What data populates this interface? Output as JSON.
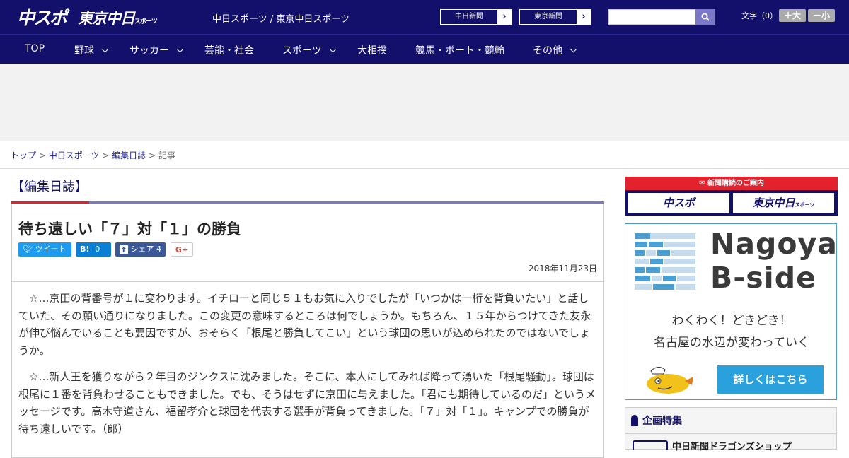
{
  "header": {
    "logo_chuspo": "中スポ",
    "logo_tokyo": "東京中日",
    "logo_tokyo_sub": "スポーツ",
    "site_name": "中日スポーツ / 東京中日スポーツ",
    "paper_links": [
      "中日新聞",
      "東京新聞"
    ],
    "search_placeholder": "",
    "font_size_label": "文字（0）",
    "font_buttons": [
      "＋大",
      "－小"
    ]
  },
  "nav": {
    "items": [
      {
        "label": "TOP",
        "has_menu": false
      },
      {
        "label": "野球",
        "has_menu": true
      },
      {
        "label": "サッカー",
        "has_menu": true
      },
      {
        "label": "芸能・社会",
        "has_menu": false
      },
      {
        "label": "スポーツ",
        "has_menu": true
      },
      {
        "label": "大相撲",
        "has_menu": false
      },
      {
        "label": "競馬・ボート・競輪",
        "has_menu": false
      },
      {
        "label": "その他",
        "has_menu": true
      }
    ]
  },
  "breadcrumb": {
    "items": [
      "トップ",
      "中日スポーツ",
      "編集日誌"
    ],
    "current": "記事",
    "separator": " > "
  },
  "article": {
    "section": "【編集日誌】",
    "headline": "待ち遠しい「７」対「１」の勝負",
    "share": {
      "tweet_label": "ツイート",
      "hatena_label": "B!",
      "hatena_count": "0",
      "facebook_label": "シェア",
      "facebook_count": "4",
      "gplus_label": "G+"
    },
    "date": "2018年11月23日",
    "paragraphs": [
      "☆…京田の背番号が１に変わります。イチローと同じ５１もお気に入りでしたが「いつかは一桁を背負いたい」と話していた、その願い通りになりました。この変更の意味するところは何でしょうか。もちろん、１５年からつけてきた友永が伸び悩んでいることも要因ですが、おそらく「根尾と勝負してこい」という球団の思いが込められたのではないでしょうか。",
      "☆…新人王を獲りながら２年目のジンクスに沈みました。そこに、本人にしてみれば降って湧いた「根尾騒動」。球団は根尾に１番を背負わせることもできました。でも、そうはせずに京田に与えました。「君にも期待しているのだ」というメッセージです。高木守道さん、福留孝介と球団を代表する選手が背負ってきました。「７」対「１」。キャンプでの勝負が待ち遠しいです。（郎）"
    ]
  },
  "sidebar": {
    "subscribe": {
      "heading": "新聞購読のご案内",
      "logos": [
        "中スポ",
        "東京中日"
      ],
      "logo_sub": "スポーツ"
    },
    "bside": {
      "title_line1": "Nagoya",
      "title_line2": "B-side",
      "copy_line1": "わくわく！どきどき！",
      "copy_line2": "名古屋の水辺が変わっていく",
      "button": "詳しくはこちら"
    },
    "kikaku": {
      "heading": "企画特集",
      "first_item": "中日新聞ドラゴンズショップ"
    }
  },
  "colors": {
    "brand_navy": "#13106b",
    "accent_red": "#e4222e",
    "accent_purple": "#7c78c8",
    "bside_blue": "#2aa0dd"
  }
}
